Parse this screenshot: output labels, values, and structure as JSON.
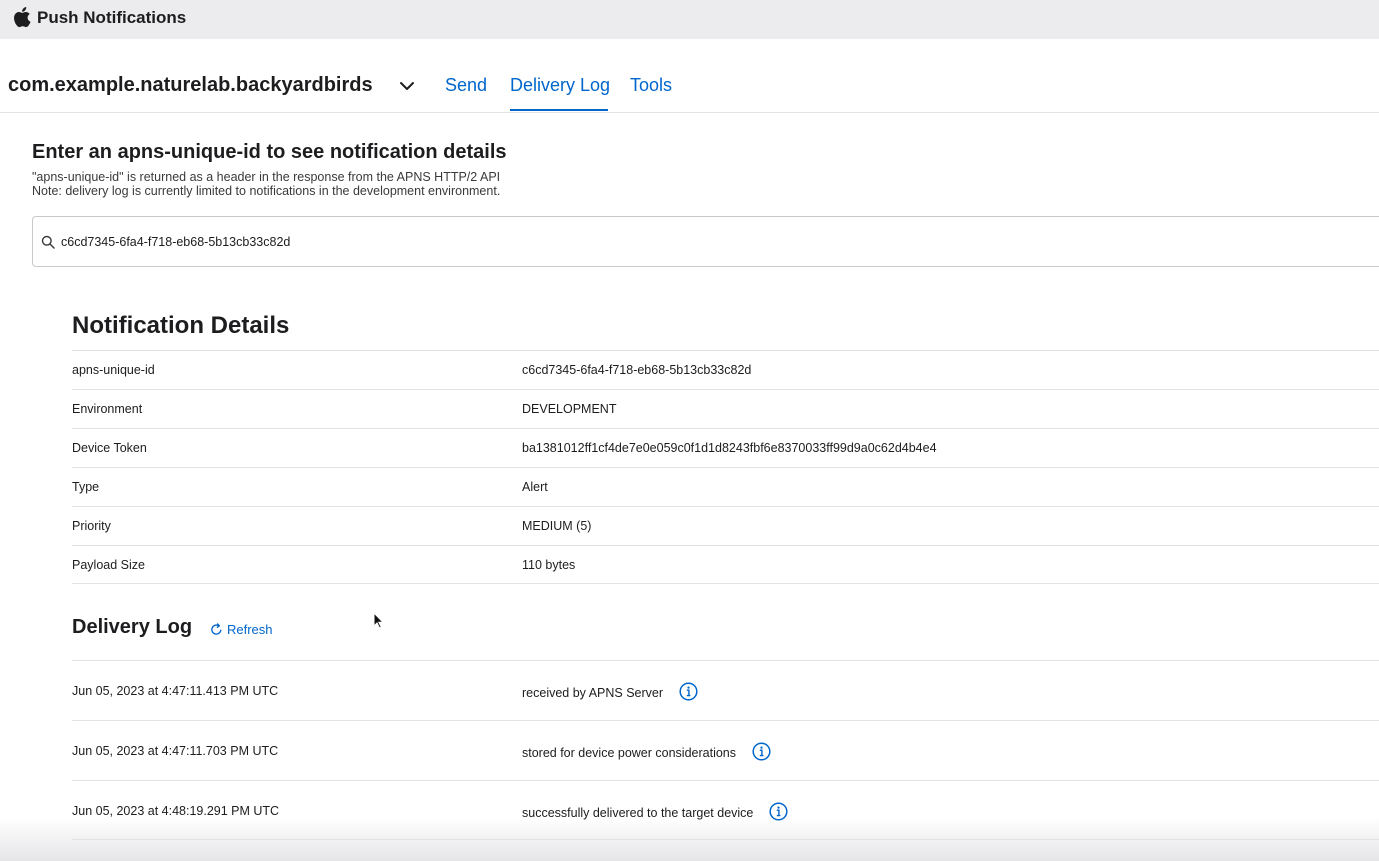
{
  "app": {
    "title": "Push Notifications"
  },
  "nav": {
    "bundle_id": "com.example.naturelab.backyardbirds",
    "tabs": [
      {
        "label": "Send",
        "active": false
      },
      {
        "label": "Delivery Log",
        "active": true
      },
      {
        "label": "Tools",
        "active": false
      }
    ]
  },
  "lookup": {
    "heading": "Enter an apns-unique-id to see notification details",
    "note_1": "\"apns-unique-id\" is returned as a header in the response from the APNS HTTP/2 API",
    "note_2": "Note: delivery log is currently limited to notifications in the development environment.",
    "search_value": "c6cd7345-6fa4-f718-eb68-5b13cb33c82d"
  },
  "details": {
    "heading": "Notification Details",
    "rows": [
      {
        "key": "apns-unique-id",
        "value": "c6cd7345-6fa4-f718-eb68-5b13cb33c82d"
      },
      {
        "key": "Environment",
        "value": "DEVELOPMENT"
      },
      {
        "key": "Device Token",
        "value": "ba1381012ff1cf4de7e0e059c0f1d1d8243fbf6e8370033ff99d9a0c62d4b4e4"
      },
      {
        "key": "Type",
        "value": "Alert"
      },
      {
        "key": "Priority",
        "value": "MEDIUM (5)"
      },
      {
        "key": "Payload Size",
        "value": "110 bytes"
      }
    ]
  },
  "delivery_log": {
    "heading": "Delivery Log",
    "refresh_label": "Refresh",
    "entries": [
      {
        "time": "Jun 05, 2023 at 4:47:11.413 PM UTC",
        "status": "received by APNS Server"
      },
      {
        "time": "Jun 05, 2023 at 4:47:11.703 PM UTC",
        "status": "stored for device power considerations"
      },
      {
        "time": "Jun 05, 2023 at 4:48:19.291 PM UTC",
        "status": "successfully delivered to the target device"
      }
    ]
  },
  "colors": {
    "accent": "#0066cc",
    "topbar": "#ececef",
    "divider": "#e3e3e6"
  },
  "icons": [
    "apple-logo-icon",
    "chevron-down-icon",
    "search-icon",
    "refresh-icon",
    "info-icon"
  ]
}
